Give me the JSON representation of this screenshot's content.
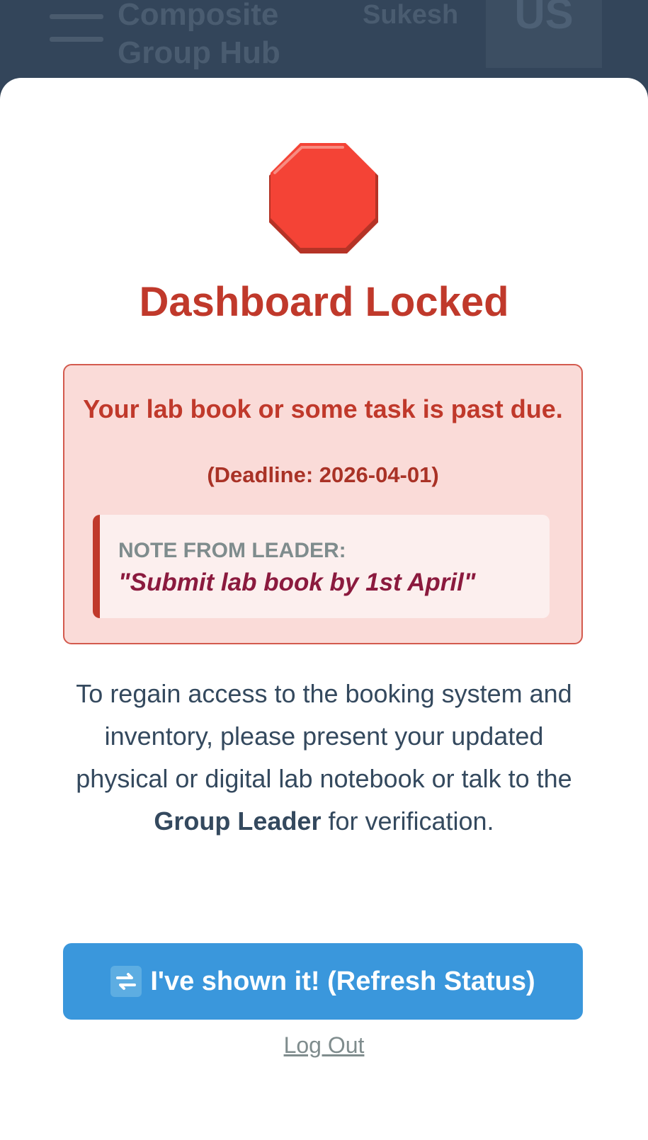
{
  "app_bar": {
    "title_line1": "Composite",
    "title_line2": "Group Hub",
    "user_name": "Sukesh",
    "user_initials": "US"
  },
  "modal": {
    "icon": "stop-sign-icon",
    "title": "Dashboard Locked",
    "alert": {
      "message": "Your lab book or some task is past due.",
      "deadline": "(Deadline: 2026-04-01)",
      "note_label": "NOTE FROM LEADER:",
      "note_text": "\"Submit lab book by 1st April\""
    },
    "info": {
      "before": "To regain access to the booking system and inventory, please present your updated physical or digital lab notebook or talk to the ",
      "emphasis": "Group Leader",
      "after": " for verification."
    },
    "refresh_button_label": "I've shown it! (Refresh Status)",
    "logout_label": "Log Out"
  },
  "colors": {
    "accent_red": "#c0392b",
    "alert_bg": "#fadbd8",
    "button_blue": "#3a97dc",
    "header_bg": "#33455a"
  }
}
